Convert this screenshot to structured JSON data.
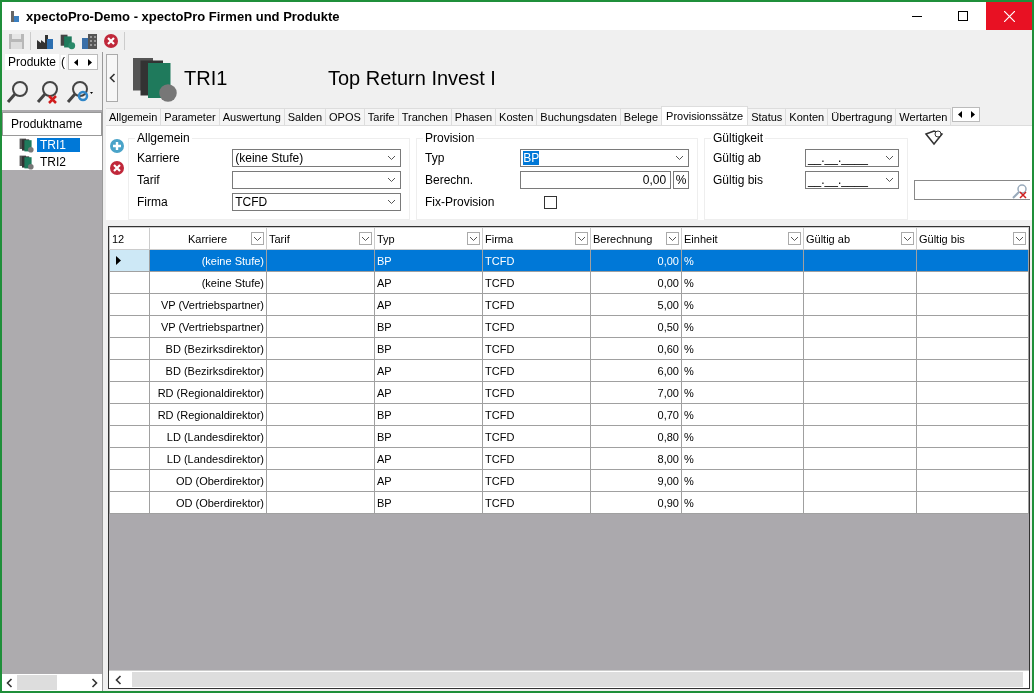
{
  "window": {
    "title": "xpectoPro-Demo - xpectoPro Firmen und Produkte"
  },
  "sidebar": {
    "tab": "Produkte",
    "tab_cut": "(",
    "tree_header": "Produktname",
    "items": [
      {
        "label": "TRI1",
        "selected": true
      },
      {
        "label": "TRI2",
        "selected": false
      }
    ]
  },
  "header": {
    "code": "TRI1",
    "name": "Top Return Invest I"
  },
  "tabs": [
    {
      "label": "Allgemein",
      "selected": false
    },
    {
      "label": "Parameter",
      "selected": false
    },
    {
      "label": "Auswertung",
      "selected": false
    },
    {
      "label": "Salden",
      "selected": false
    },
    {
      "label": "OPOS",
      "selected": false
    },
    {
      "label": "Tarife",
      "selected": false
    },
    {
      "label": "Tranchen",
      "selected": false
    },
    {
      "label": "Phasen",
      "selected": false
    },
    {
      "label": "Kosten",
      "selected": false
    },
    {
      "label": "Buchungsdaten",
      "selected": false
    },
    {
      "label": "Belege",
      "selected": false
    },
    {
      "label": "Provisionssätze",
      "selected": true
    },
    {
      "label": "Status",
      "selected": false
    },
    {
      "label": "Konten",
      "selected": false
    },
    {
      "label": "Übertragung",
      "selected": false
    },
    {
      "label": "Wertarten",
      "selected": false
    }
  ],
  "form": {
    "allgemein": {
      "title": "Allgemein",
      "fields": [
        {
          "label": "Karriere",
          "value": "(keine Stufe)"
        },
        {
          "label": "Tarif"
        },
        {
          "label": "Firma",
          "value": "TCFD"
        }
      ]
    },
    "provision": {
      "title": "Provision",
      "typ": {
        "label": "Typ",
        "value": "BP"
      },
      "berechnung": {
        "label": "Berechn.",
        "value": "0,00",
        "unit": "%"
      },
      "fix": {
        "label": "Fix-Provision",
        "checked": false
      }
    },
    "gueltigkeit": {
      "title": "Gültigkeit",
      "fields": [
        {
          "label": "Gültig ab",
          "value": "__.__.____"
        },
        {
          "label": "Gültig bis",
          "value": "__.__.____"
        }
      ]
    }
  },
  "grid": {
    "count": "12",
    "columns": [
      "Karriere",
      "Tarif",
      "Typ",
      "Firma",
      "Berechnung",
      "Einheit",
      "Gültig ab",
      "Gültig bis"
    ],
    "rows": [
      {
        "selected": true,
        "karriere": "(keine Stufe)",
        "typ": "BP",
        "firma": "TCFD",
        "berechnung": "0,00",
        "einheit": "%"
      },
      {
        "selected": false,
        "karriere": "(keine Stufe)",
        "typ": "AP",
        "firma": "TCFD",
        "berechnung": "0,00",
        "einheit": "%"
      },
      {
        "selected": false,
        "karriere": "VP (Vertriebspartner)",
        "typ": "AP",
        "firma": "TCFD",
        "berechnung": "5,00",
        "einheit": "%"
      },
      {
        "selected": false,
        "karriere": "VP (Vertriebspartner)",
        "typ": "BP",
        "firma": "TCFD",
        "berechnung": "0,50",
        "einheit": "%"
      },
      {
        "selected": false,
        "karriere": "BD (Bezirksdirektor)",
        "typ": "BP",
        "firma": "TCFD",
        "berechnung": "0,60",
        "einheit": "%"
      },
      {
        "selected": false,
        "karriere": "BD (Bezirksdirektor)",
        "typ": "AP",
        "firma": "TCFD",
        "berechnung": "6,00",
        "einheit": "%"
      },
      {
        "selected": false,
        "karriere": "RD (Regionaldirektor)",
        "typ": "AP",
        "firma": "TCFD",
        "berechnung": "7,00",
        "einheit": "%"
      },
      {
        "selected": false,
        "karriere": "RD (Regionaldirektor)",
        "typ": "BP",
        "firma": "TCFD",
        "berechnung": "0,70",
        "einheit": "%"
      },
      {
        "selected": false,
        "karriere": "LD (Landesdirektor)",
        "typ": "BP",
        "firma": "TCFD",
        "berechnung": "0,80",
        "einheit": "%"
      },
      {
        "selected": false,
        "karriere": "LD (Landesdirektor)",
        "typ": "AP",
        "firma": "TCFD",
        "berechnung": "8,00",
        "einheit": "%"
      },
      {
        "selected": false,
        "karriere": "OD (Oberdirektor)",
        "typ": "AP",
        "firma": "TCFD",
        "berechnung": "9,00",
        "einheit": "%"
      },
      {
        "selected": false,
        "karriere": "OD (Oberdirektor)",
        "typ": "BP",
        "firma": "TCFD",
        "berechnung": "0,90",
        "einheit": "%"
      }
    ]
  }
}
